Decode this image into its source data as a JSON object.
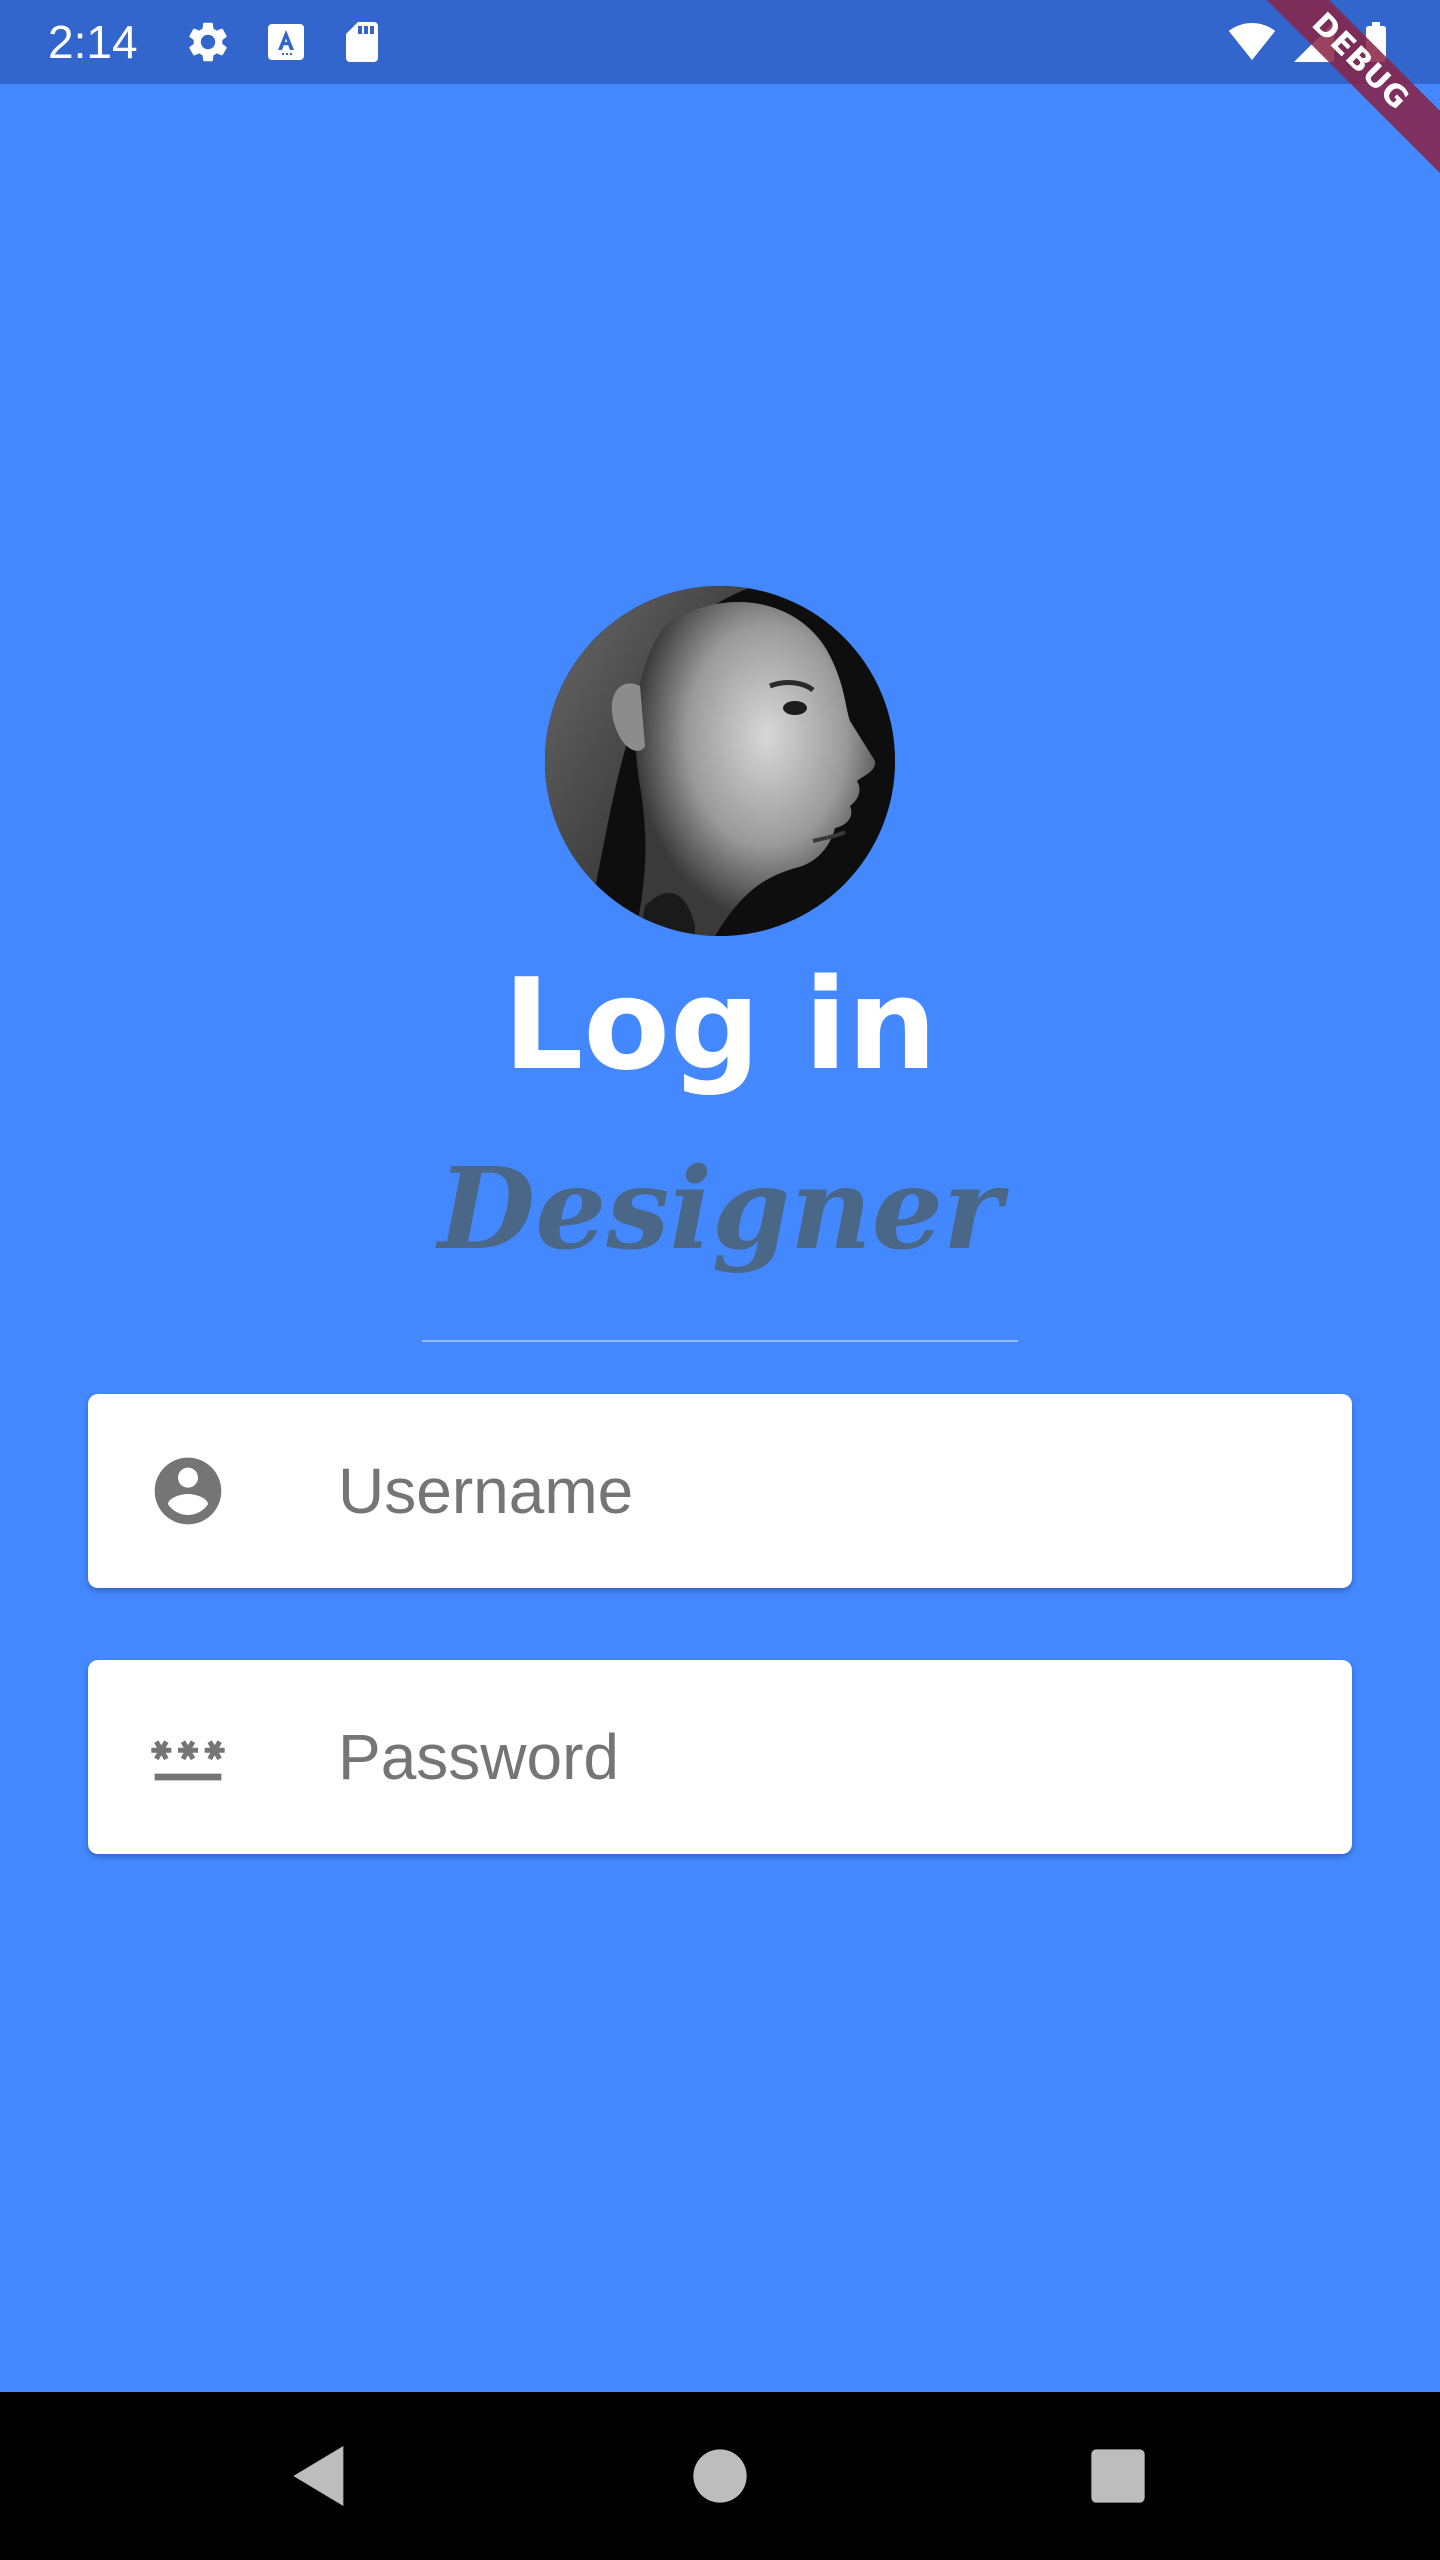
{
  "status_bar": {
    "time": "2:14",
    "icons": [
      "gear-icon",
      "text-a-icon",
      "sd-card-icon",
      "wifi-icon",
      "signal-icon",
      "battery-icon"
    ],
    "background": "#3366CC",
    "debug_label": "DEBUG"
  },
  "screen": {
    "background": "#4488FF",
    "title": "Log in",
    "subtitle": "Designer",
    "subtitle_color": "#4A6787"
  },
  "form": {
    "username": {
      "placeholder": "Username",
      "value": "",
      "icon": "account-circle-icon"
    },
    "password": {
      "placeholder": "Password",
      "value": "",
      "icon": "password-icon"
    }
  },
  "nav_bar": {
    "buttons": [
      "back-icon",
      "home-icon",
      "recents-icon"
    ]
  }
}
